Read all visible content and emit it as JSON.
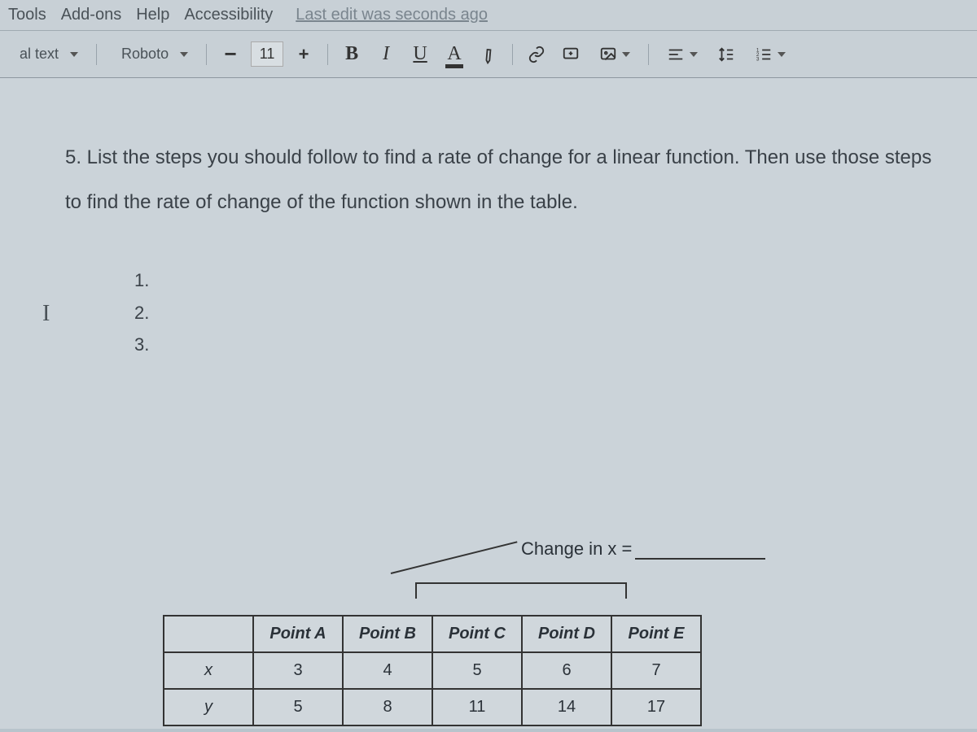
{
  "menubar": {
    "items": [
      "Tools",
      "Add-ons",
      "Help",
      "Accessibility"
    ],
    "status": "Last edit was seconds ago"
  },
  "toolbar": {
    "style_label": "al text",
    "font_label": "Roboto",
    "font_size": "11",
    "bold": "B",
    "italic": "I",
    "underline": "U",
    "textcolor": "A"
  },
  "document": {
    "question": "5. List the steps you should follow to find a rate of change for a linear function. Then use those steps to find the rate of change of the function shown in the table.",
    "cursor": "I",
    "steps": [
      "1.",
      "2.",
      "3."
    ],
    "change_label": "Change in x =",
    "table": {
      "headers": [
        "",
        "Point A",
        "Point B",
        "Point C",
        "Point D",
        "Point E"
      ],
      "rows": [
        {
          "label": "x",
          "values": [
            "3",
            "4",
            "5",
            "6",
            "7"
          ]
        },
        {
          "label": "y",
          "values": [
            "5",
            "8",
            "11",
            "14",
            "17"
          ]
        }
      ]
    }
  },
  "chart_data": {
    "type": "table",
    "title": "Rate of change function table",
    "columns": [
      "Point A",
      "Point B",
      "Point C",
      "Point D",
      "Point E"
    ],
    "series": [
      {
        "name": "x",
        "values": [
          3,
          4,
          5,
          6,
          7
        ]
      },
      {
        "name": "y",
        "values": [
          5,
          8,
          11,
          14,
          17
        ]
      }
    ],
    "annotation": "Change in x ="
  }
}
